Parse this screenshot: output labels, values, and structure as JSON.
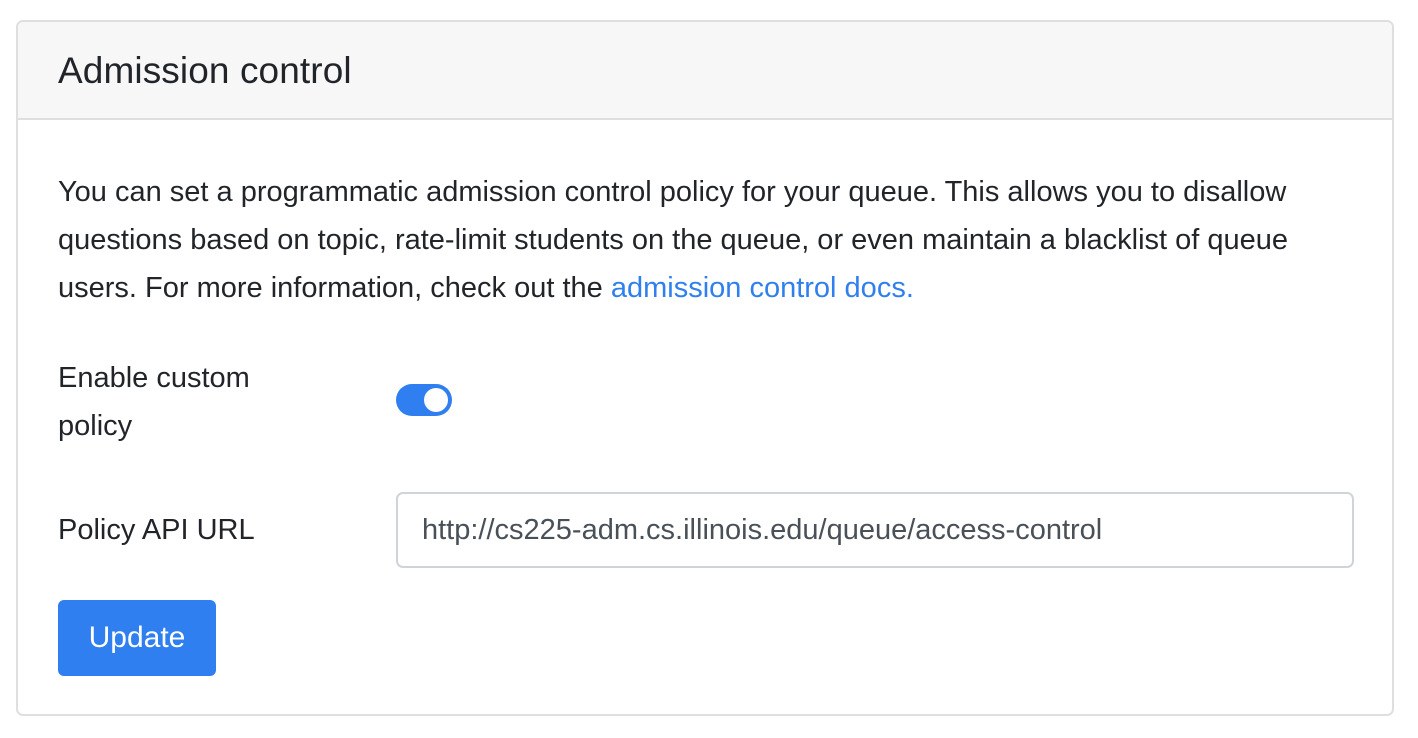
{
  "card": {
    "title": "Admission control",
    "description_text": "You can set a programmatic admission control policy for your queue. This allows you to disallow questions based on topic, rate-limit students on the queue, or even maintain a blacklist of queue users. For more information, check out the ",
    "docs_link_text": "admission control docs."
  },
  "form": {
    "enable_policy_label": "Enable custom policy",
    "enable_policy_on": true,
    "policy_url_label": "Policy API URL",
    "policy_url_value": "http://cs225-adm.cs.illinois.edu/queue/access-control",
    "update_button_label": "Update"
  },
  "colors": {
    "accent": "#2f7ff0",
    "link": "#2f80ed",
    "header_bg": "#f7f7f7",
    "border": "#dfdfdf"
  }
}
